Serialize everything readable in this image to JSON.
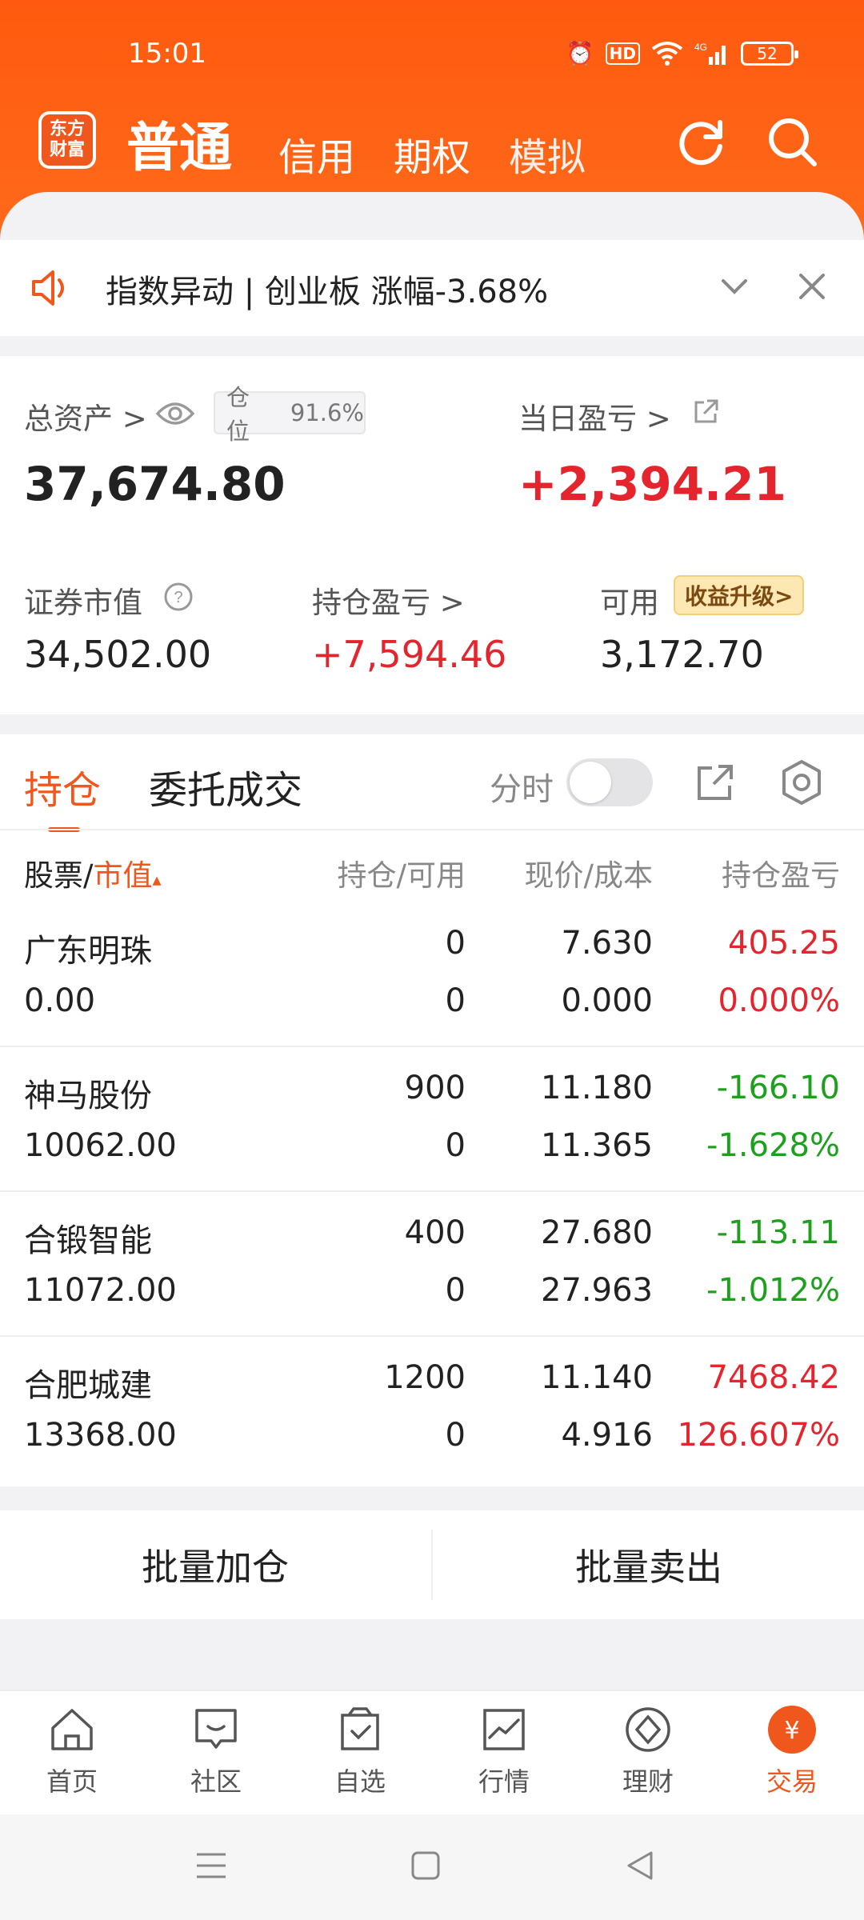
{
  "status": {
    "time": "15:01",
    "battery": "52"
  },
  "nav": {
    "logo_line1": "东方",
    "logo_line2": "财富",
    "tabs": [
      "普通",
      "信用",
      "期权",
      "模拟"
    ]
  },
  "notice": {
    "text": "指数异动 | 创业板 涨幅-3.68%"
  },
  "assets": {
    "total_label": "总资产 >",
    "position_label": "仓位",
    "position_value": "91.6%",
    "total_value": "37,674.80",
    "daily_pl_label": "当日盈亏 >",
    "daily_pl_value": "+2,394.21",
    "market_value_label": "证券市值",
    "market_value": "34,502.00",
    "holding_pl_label": "持仓盈亏 >",
    "holding_pl_value": "+7,594.46",
    "available_label": "可用",
    "upgrade_label": "收益升级>",
    "available_value": "3,172.70"
  },
  "holdings": {
    "tab_active": "持仓",
    "tab_other": "委托成交",
    "fenshi_label": "分时",
    "columns": {
      "stock": "股票/",
      "market": "市值",
      "position": "持仓/可用",
      "price": "现价/成本",
      "pl": "持仓盈亏"
    },
    "rows": [
      {
        "name": "广东明珠",
        "value": "0.00",
        "pos": "0",
        "avail": "0",
        "price": "7.630",
        "cost": "0.000",
        "pl": "405.25",
        "pl_pct": "0.000%",
        "color": "red"
      },
      {
        "name": "神马股份",
        "value": "10062.00",
        "pos": "900",
        "avail": "0",
        "price": "11.180",
        "cost": "11.365",
        "pl": "-166.10",
        "pl_pct": "-1.628%",
        "color": "green"
      },
      {
        "name": "合锻智能",
        "value": "11072.00",
        "pos": "400",
        "avail": "0",
        "price": "27.680",
        "cost": "27.963",
        "pl": "-113.11",
        "pl_pct": "-1.012%",
        "color": "green"
      },
      {
        "name": "合肥城建",
        "value": "13368.00",
        "pos": "1200",
        "avail": "0",
        "price": "11.140",
        "cost": "4.916",
        "pl": "7468.42",
        "pl_pct": "126.607%",
        "color": "red"
      }
    ]
  },
  "batch": {
    "add": "批量加仓",
    "sell": "批量卖出"
  },
  "bottom_nav": [
    {
      "label": "首页",
      "icon": "home-icon"
    },
    {
      "label": "社区",
      "icon": "community-icon"
    },
    {
      "label": "自选",
      "icon": "watchlist-icon"
    },
    {
      "label": "行情",
      "icon": "market-icon"
    },
    {
      "label": "理财",
      "icon": "finance-icon"
    },
    {
      "label": "交易",
      "icon": "trade-icon"
    }
  ],
  "colors": {
    "accent": "#f0571c",
    "up": "#e5252e",
    "down": "#1ea01e"
  }
}
